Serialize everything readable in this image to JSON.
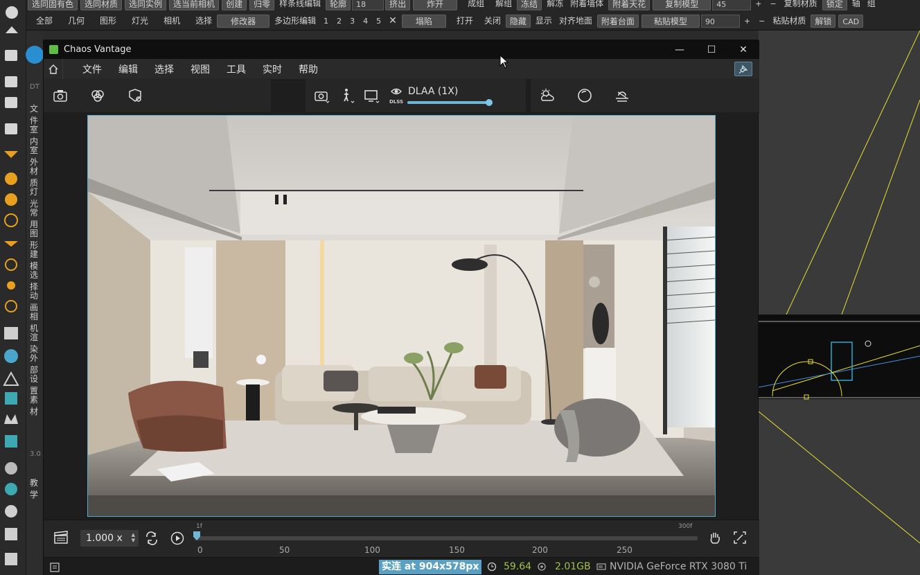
{
  "host": {
    "toolbar_row1": [
      "选同固有色",
      "选同材质",
      "选同实例",
      "选当前相机",
      "创建",
      "归零",
      "样条线编辑",
      "轮廓",
      "18",
      "挤出",
      "炸开",
      "成组",
      "解组",
      "冻结",
      "解冻",
      "附着墙体",
      "附着天花",
      "复制模型",
      "45",
      "+",
      "−",
      "复制材质",
      "锁定",
      "轴",
      "组"
    ],
    "toolbar_row2": [
      "全部",
      "几何",
      "图形",
      "灯光",
      "相机",
      "选择",
      "修改器",
      "多边形编辑",
      "1",
      "2",
      "3",
      "4",
      "5",
      "塌陷",
      "打开",
      "关闭",
      "隐藏",
      "显示",
      "对齐地面",
      "附着台面",
      "粘贴模型",
      "90",
      "+",
      "−",
      "粘贴材质",
      "解锁",
      "CAD"
    ],
    "side_labels": [
      "文件",
      "室内",
      "室外",
      "材质",
      "灯光",
      "常用",
      "图形",
      "建模",
      "选择",
      "动画",
      "相机",
      "渲染",
      "外部",
      "设置",
      "素材",
      "教学"
    ],
    "side_extra": [
      "DT",
      "3.0"
    ]
  },
  "vantage": {
    "title": "Chaos Vantage",
    "window_controls": {
      "minimize": "—",
      "maximize": "☐",
      "close": "✕"
    },
    "menu": [
      "文件",
      "编辑",
      "选择",
      "视图",
      "工具",
      "实时",
      "帮助"
    ],
    "toolbar": {
      "dlaa_label": "DLAA (1X)",
      "dlss": "DLSS",
      "dlaa_level": 1.0
    },
    "timeline": {
      "speed": "1.000 x",
      "start_frame_label": "1f",
      "end_frame_label": "300f",
      "ticks": [
        "0",
        "50",
        "100",
        "150",
        "200",
        "250"
      ]
    },
    "status": {
      "mode": "实连 at 904x578px",
      "fps": "59.64",
      "memory": "2.01GB",
      "gpu": "NVIDIA GeForce RTX 3080 Ti"
    }
  }
}
